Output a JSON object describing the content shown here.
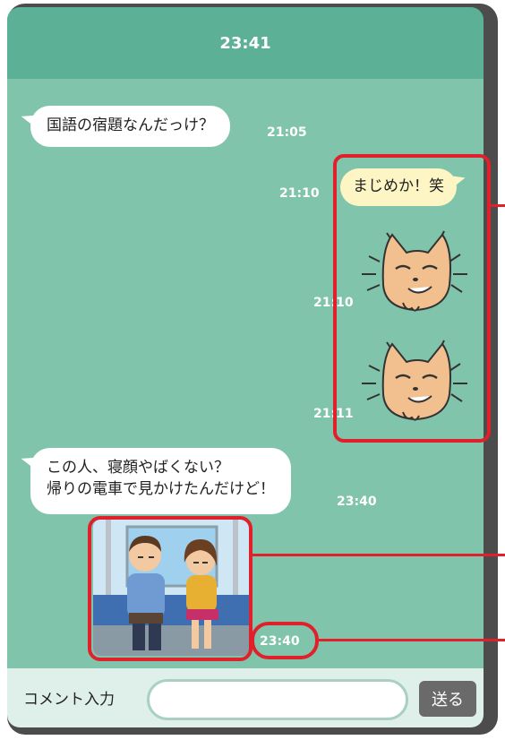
{
  "header": {
    "time": "23:41"
  },
  "messages": [
    {
      "side": "left",
      "text": "国語の宿題なんだっけ？",
      "time": "21:05"
    },
    {
      "side": "right",
      "text": "まじめか！笑",
      "time": "21:10"
    },
    {
      "side": "right",
      "type": "sticker",
      "sticker": "cat-smirk-sticker",
      "time": "21:10"
    },
    {
      "side": "right",
      "type": "sticker",
      "sticker": "cat-smirk-sticker",
      "time": "21:11"
    },
    {
      "side": "left",
      "lines": [
        "この人、寝顔やばくない？",
        "帰りの電車で見かけたんだけど！"
      ],
      "time": "23:40"
    },
    {
      "side": "left",
      "type": "photo",
      "photo": "couple-sleeping-on-train-photo",
      "time": "23:40"
    }
  ],
  "footer": {
    "comment_label": "コメント入力",
    "input_value": "",
    "send_label": "送る"
  },
  "colors": {
    "header": "#5bb095",
    "chat_background": "#80c4ab",
    "my_bubble": "#fdf6c4",
    "highlight": "#e0202a"
  }
}
